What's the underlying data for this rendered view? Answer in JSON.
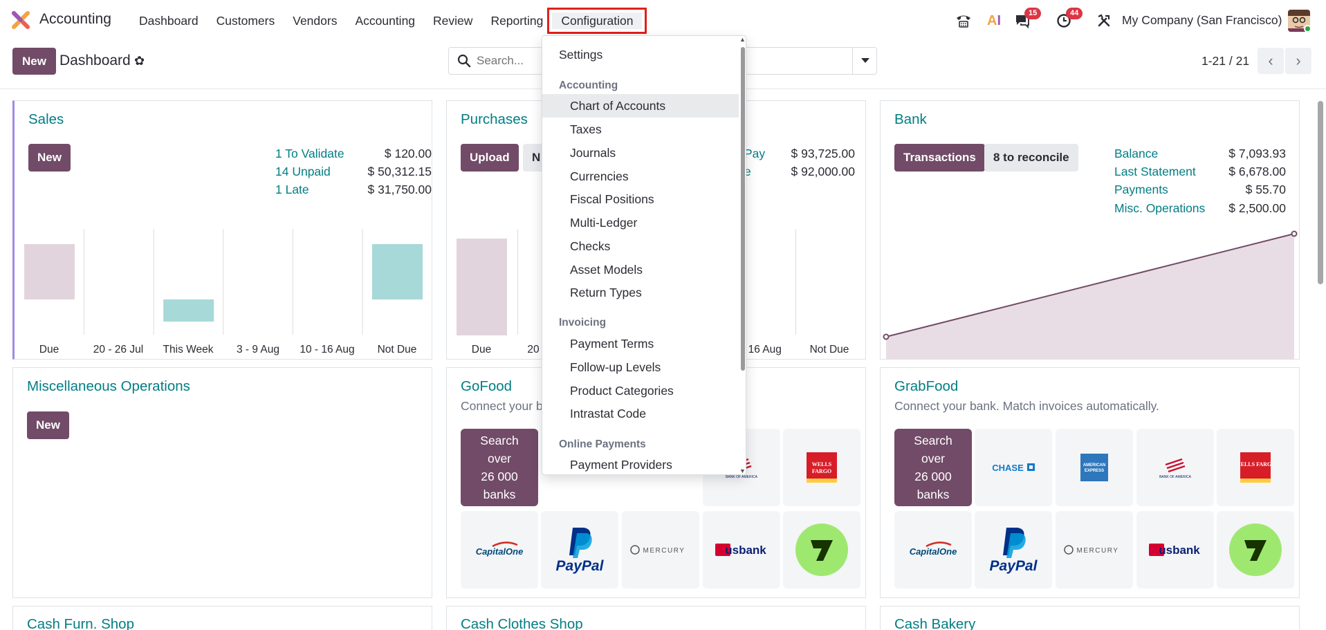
{
  "navbar": {
    "app_name": "Accounting",
    "menu": [
      "Dashboard",
      "Customers",
      "Vendors",
      "Accounting",
      "Review",
      "Reporting",
      "Configuration"
    ],
    "active_menu": "Configuration",
    "chat_badge": "15",
    "activity_badge": "44",
    "company": "My Company (San Francisco)"
  },
  "control_panel": {
    "new_label": "New",
    "title": "Dashboard",
    "search_placeholder": "Search...",
    "pager": "1-21 / 21"
  },
  "sales": {
    "title": "Sales",
    "new_label": "New",
    "stats": [
      {
        "label": "1 To Validate",
        "value": "$ 120.00"
      },
      {
        "label": "14 Unpaid",
        "value": "$ 50,312.15"
      },
      {
        "label": "1 Late",
        "value": "$ 31,750.00"
      }
    ],
    "chart_data": {
      "type": "bar",
      "categories": [
        "Due",
        "20 - 26 Jul",
        "This Week",
        "3 - 9 Aug",
        "10 - 16 Aug",
        "Not Due"
      ],
      "values": [
        1,
        0,
        0.4,
        0,
        0,
        1
      ],
      "colors": [
        "#e2d4dc",
        "",
        "#a6d9d7",
        "",
        "",
        "#a6d9d7"
      ]
    }
  },
  "purchases": {
    "title": "Purchases",
    "upload_label": "Upload",
    "new_label": "N",
    "stats": [
      {
        "label": "Pay",
        "value": "$ 93,725.00"
      },
      {
        "label": "e",
        "value": "$ 92,000.00"
      }
    ],
    "xlabels": [
      "Due",
      "20",
      "- 16 Aug",
      "Not Due"
    ]
  },
  "bank": {
    "title": "Bank",
    "transactions_label": "Transactions",
    "reconcile_label": "8 to reconcile",
    "stats": [
      {
        "label": "Balance",
        "value": "$ 7,093.93"
      },
      {
        "label": "Last Statement",
        "value": "$ 6,678.00"
      },
      {
        "label": "Payments",
        "value": "$ 55.70"
      },
      {
        "label": "Misc. Operations",
        "value": "$ 2,500.00"
      }
    ]
  },
  "misc": {
    "title": "Miscellaneous Operations",
    "new_label": "New"
  },
  "gofood": {
    "title": "GoFood",
    "subtitle": "Connect your b"
  },
  "grabfood": {
    "title": "GrabFood",
    "subtitle": "Connect your bank. Match invoices automatically."
  },
  "bank_search_tile": "Search over 26 000 banks",
  "bank_search_lines": [
    "Search",
    "over",
    "26 000",
    "banks"
  ],
  "bank_logos": [
    "CHASE",
    "AMERICAN EXPRESS",
    "BANK OF AMERICA",
    "WELLS FARGO",
    "CapitalOne",
    "PayPal",
    "MERCURY",
    "usbank",
    "Wise"
  ],
  "bottom_cards": [
    "Cash Furn. Shop",
    "Cash Clothes Shop",
    "Cash Bakery"
  ],
  "dropdown": {
    "settings": "Settings",
    "sections": [
      {
        "header": "Accounting",
        "items": [
          "Chart of Accounts",
          "Taxes",
          "Journals",
          "Currencies",
          "Fiscal Positions",
          "Multi-Ledger",
          "Checks",
          "Asset Models",
          "Return Types"
        ]
      },
      {
        "header": "Invoicing",
        "items": [
          "Payment Terms",
          "Follow-up Levels",
          "Product Categories",
          "Intrastat Code"
        ]
      },
      {
        "header": "Online Payments",
        "items": [
          "Payment Providers"
        ]
      }
    ],
    "hovered": "Chart of Accounts"
  },
  "colors": {
    "primary": "#714b67",
    "teal": "#017e84",
    "badge": "#dc3545",
    "highlight": "#e0201b"
  }
}
